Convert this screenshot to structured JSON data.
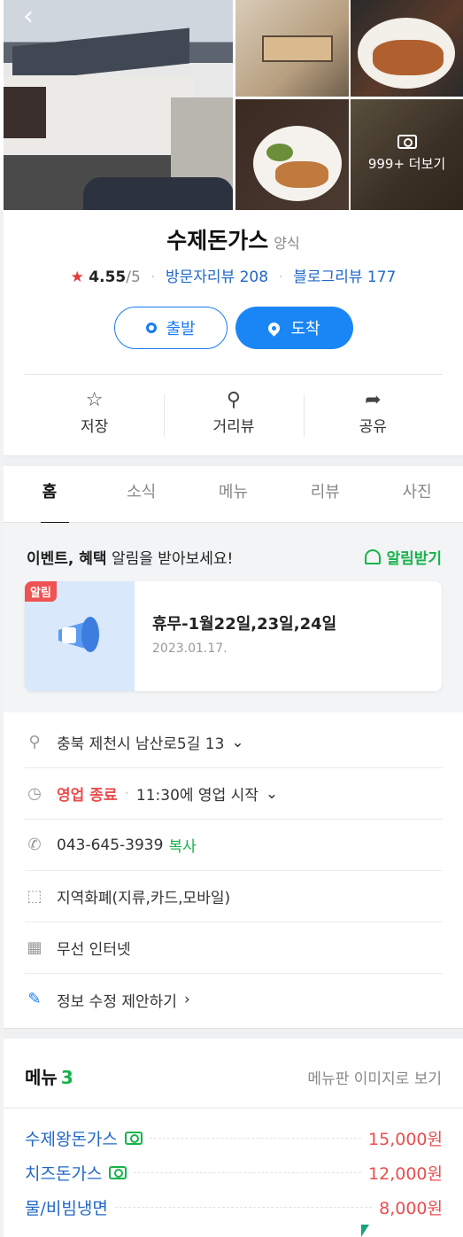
{
  "photos": {
    "more_label": "999+ 더보기"
  },
  "place": {
    "name": "수제돈가스",
    "category": "양식",
    "rating": "4.55",
    "rating_max": "/5",
    "visitor_reviews": "방문자리뷰 208",
    "blog_reviews": "블로그리뷰 177"
  },
  "buttons": {
    "start": "출발",
    "arrive": "도착"
  },
  "actions": [
    {
      "label": "저장",
      "icon": "star-icon"
    },
    {
      "label": "거리뷰",
      "icon": "map-pin-icon"
    },
    {
      "label": "공유",
      "icon": "share-icon"
    }
  ],
  "tabs": [
    "홈",
    "소식",
    "메뉴",
    "리뷰",
    "사진"
  ],
  "notice": {
    "head_bold": "이벤트, 혜택",
    "head_rest": " 알림을 받아보세요!",
    "subscribe": "알림받기",
    "badge": "알림",
    "title": "휴무-1월22일,23일,24일",
    "date": "2023.01.17."
  },
  "info": {
    "address": "충북 제천시 남산로5길 13",
    "status": "영업 종료",
    "hours": "11:30에 영업 시작",
    "phone": "043-645-3939",
    "copy": "복사",
    "payment": "지역화폐(지류,카드,모바일)",
    "wifi": "무선 인터넷",
    "edit": "정보 수정 제안하기"
  },
  "menu": {
    "title": "메뉴",
    "count": "3",
    "view_image": "메뉴판 이미지로 보기",
    "items": [
      {
        "name": "수제왕돈가스",
        "price": "15,000원"
      },
      {
        "name": "치즈돈가스",
        "price": "12,000원"
      },
      {
        "name": "물/비빔냉면",
        "price": "8,000원"
      }
    ]
  }
}
